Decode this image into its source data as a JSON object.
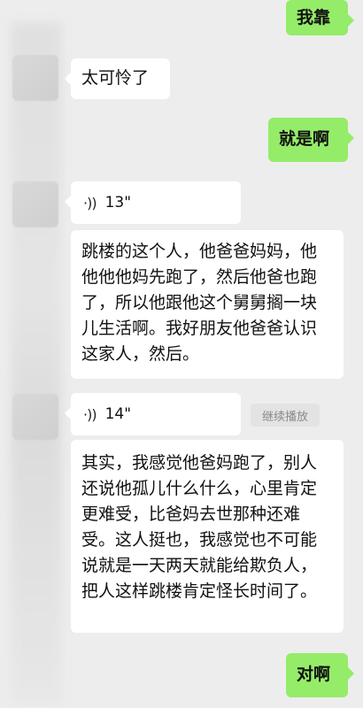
{
  "messages": {
    "m1": "我靠",
    "m2": "太可怜了",
    "m3": "就是啊",
    "voice1_duration": "13\"",
    "transcript1": "跳楼的这个人，他爸爸妈妈，他他他他妈先跑了，然后他爸也跑了，所以他跟他这个舅舅搁一块儿生活啊。我好朋友他爸爸认识这家人，然后。",
    "voice2_duration": "14\"",
    "continue_play": "继续播放",
    "transcript2": "其实，我感觉他爸妈跑了，别人还说他孤儿什么什么，心里肯定更难受，比爸妈去世那种还难受。这人挺也，我感觉也不可能说就是一天两天就能给欺负人，把人这样跳楼肯定怪长时间了。",
    "m_last": "对啊"
  },
  "colors": {
    "background": "#ededed",
    "sent_bubble": "#95ec69",
    "received_bubble": "#ffffff"
  },
  "icons": {
    "voice": "voice-wave-icon"
  }
}
